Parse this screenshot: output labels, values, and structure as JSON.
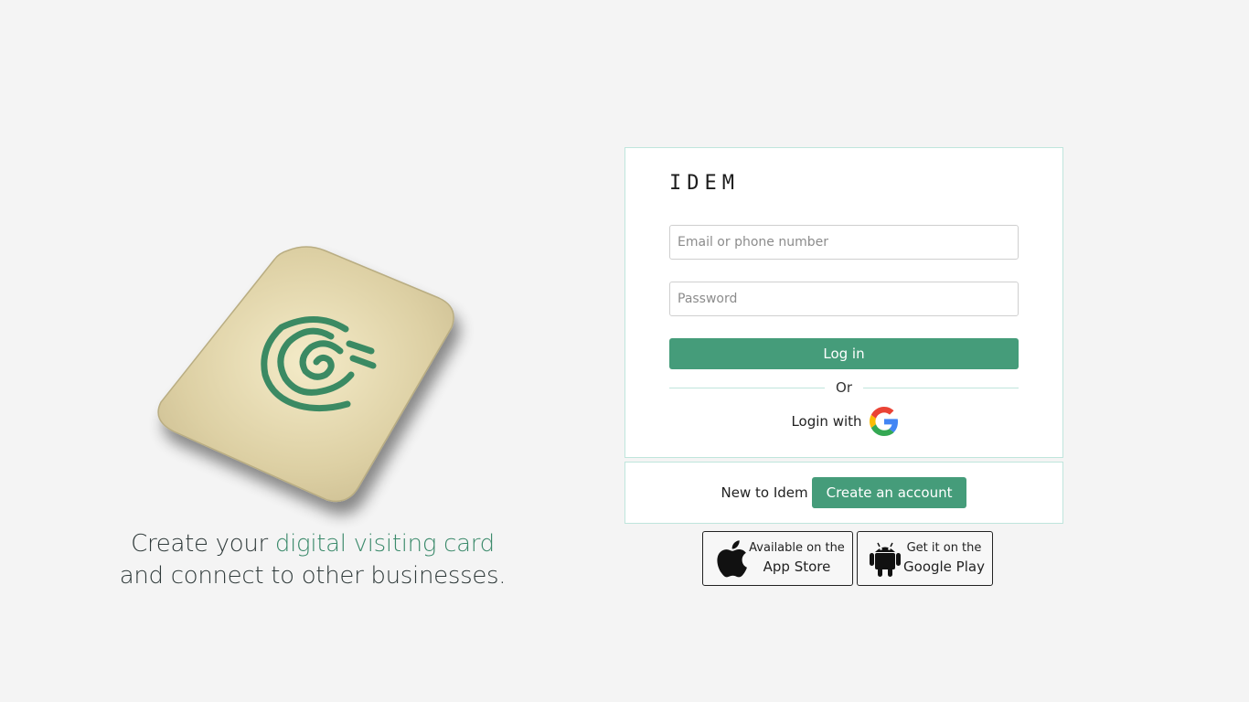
{
  "hero": {
    "tagline_plain": "Create your ",
    "tagline_accent": "digital visiting card",
    "tagline_second": "and connect to other businesses."
  },
  "login": {
    "brand": "IDEM",
    "email_placeholder": "Email or phone number",
    "password_placeholder": "Password",
    "login_label": "Log in",
    "or_label": "Or",
    "google_label": "Login with"
  },
  "signup": {
    "prompt": "New to Idem",
    "create_label": "Create an account"
  },
  "stores": {
    "apple_small": "Available on the",
    "apple_big": "App Store",
    "google_small": "Get it on the",
    "google_big": "Google Play"
  },
  "icons": {
    "hero": "fingerprint-card-icon",
    "google": "google-icon",
    "apple": "apple-icon",
    "android": "android-icon"
  },
  "colors": {
    "accent": "#459c7a",
    "border": "#bfe5dc",
    "background": "#f4f4f4"
  }
}
